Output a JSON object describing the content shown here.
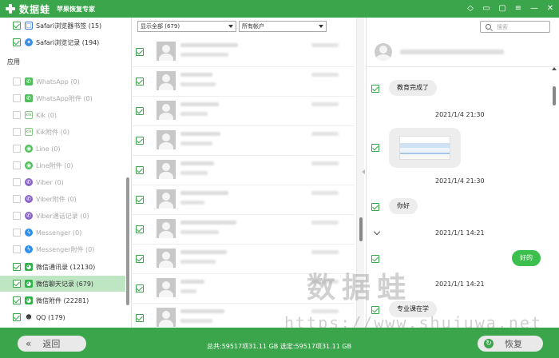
{
  "app": {
    "logo_text": "数据蛙",
    "title": "苹果恢复专家"
  },
  "left": {
    "section_header": "应用",
    "items": [
      {
        "label": "Safari浏览器书签 (15)",
        "checked": true,
        "icon": "bookmark-icon",
        "enabled": true
      },
      {
        "label": "Safari浏览记录 (194)",
        "checked": true,
        "icon": "compass-icon",
        "enabled": true
      },
      {
        "label": "WhatsApp (0)",
        "checked": false,
        "icon": "whatsapp-icon",
        "enabled": false
      },
      {
        "label": "WhatsApp附件 (0)",
        "checked": false,
        "icon": "whatsapp-icon",
        "enabled": false
      },
      {
        "label": "Kik (0)",
        "checked": false,
        "icon": "kik-icon",
        "enabled": false
      },
      {
        "label": "Kik附件 (0)",
        "checked": false,
        "icon": "kik-icon",
        "enabled": false
      },
      {
        "label": "Line (0)",
        "checked": false,
        "icon": "line-icon",
        "enabled": false
      },
      {
        "label": "Line附件 (0)",
        "checked": false,
        "icon": "line-icon",
        "enabled": false
      },
      {
        "label": "Viber (0)",
        "checked": false,
        "icon": "viber-icon",
        "enabled": false
      },
      {
        "label": "Viber附件 (0)",
        "checked": false,
        "icon": "viber-icon",
        "enabled": false
      },
      {
        "label": "Viber通话记录 (0)",
        "checked": false,
        "icon": "viber-icon",
        "enabled": false
      },
      {
        "label": "Messenger (0)",
        "checked": false,
        "icon": "messenger-icon",
        "enabled": false
      },
      {
        "label": "Messenger附件 (0)",
        "checked": false,
        "icon": "messenger-icon",
        "enabled": false
      },
      {
        "label": "微信通讯录 (12130)",
        "checked": true,
        "icon": "wechat-icon",
        "enabled": true
      },
      {
        "label": "微信聊天记录 (679)",
        "checked": true,
        "icon": "wechat-icon",
        "enabled": true,
        "selected": true
      },
      {
        "label": "微信附件 (22281)",
        "checked": true,
        "icon": "wechat-icon",
        "enabled": true
      },
      {
        "label": "QQ (179)",
        "checked": true,
        "icon": "qq-icon",
        "enabled": true
      }
    ]
  },
  "middle": {
    "filter_show": "显示全部 (679)",
    "filter_account": "所有帐户",
    "row_count": 10
  },
  "right": {
    "search_placeholder": "搜索",
    "messages": [
      {
        "kind": "in",
        "text": "教育完成了"
      },
      {
        "kind": "time",
        "text": "2021/1/4 21:30"
      },
      {
        "kind": "in-image"
      },
      {
        "kind": "time",
        "text": "2021/1/4 21:30"
      },
      {
        "kind": "in",
        "text": "你好"
      },
      {
        "kind": "time",
        "text": "2021/1/1 14:21"
      },
      {
        "kind": "out",
        "text": "好的"
      },
      {
        "kind": "time",
        "text": "2021/1/1 14:21"
      },
      {
        "kind": "in",
        "text": "专业课在学"
      }
    ]
  },
  "bottom": {
    "back_label": "返回",
    "status": "总共:59517项31.11 GB 选定:59517项31.11 GB",
    "recover_label": "恢复"
  },
  "watermark": {
    "line1": "数据蛙",
    "line2": "https://www.shujuwa.net"
  },
  "colors": {
    "brand": "#3aa54a",
    "selected_row": "#bfe6c3",
    "out_bubble": "#3dbf4e"
  }
}
